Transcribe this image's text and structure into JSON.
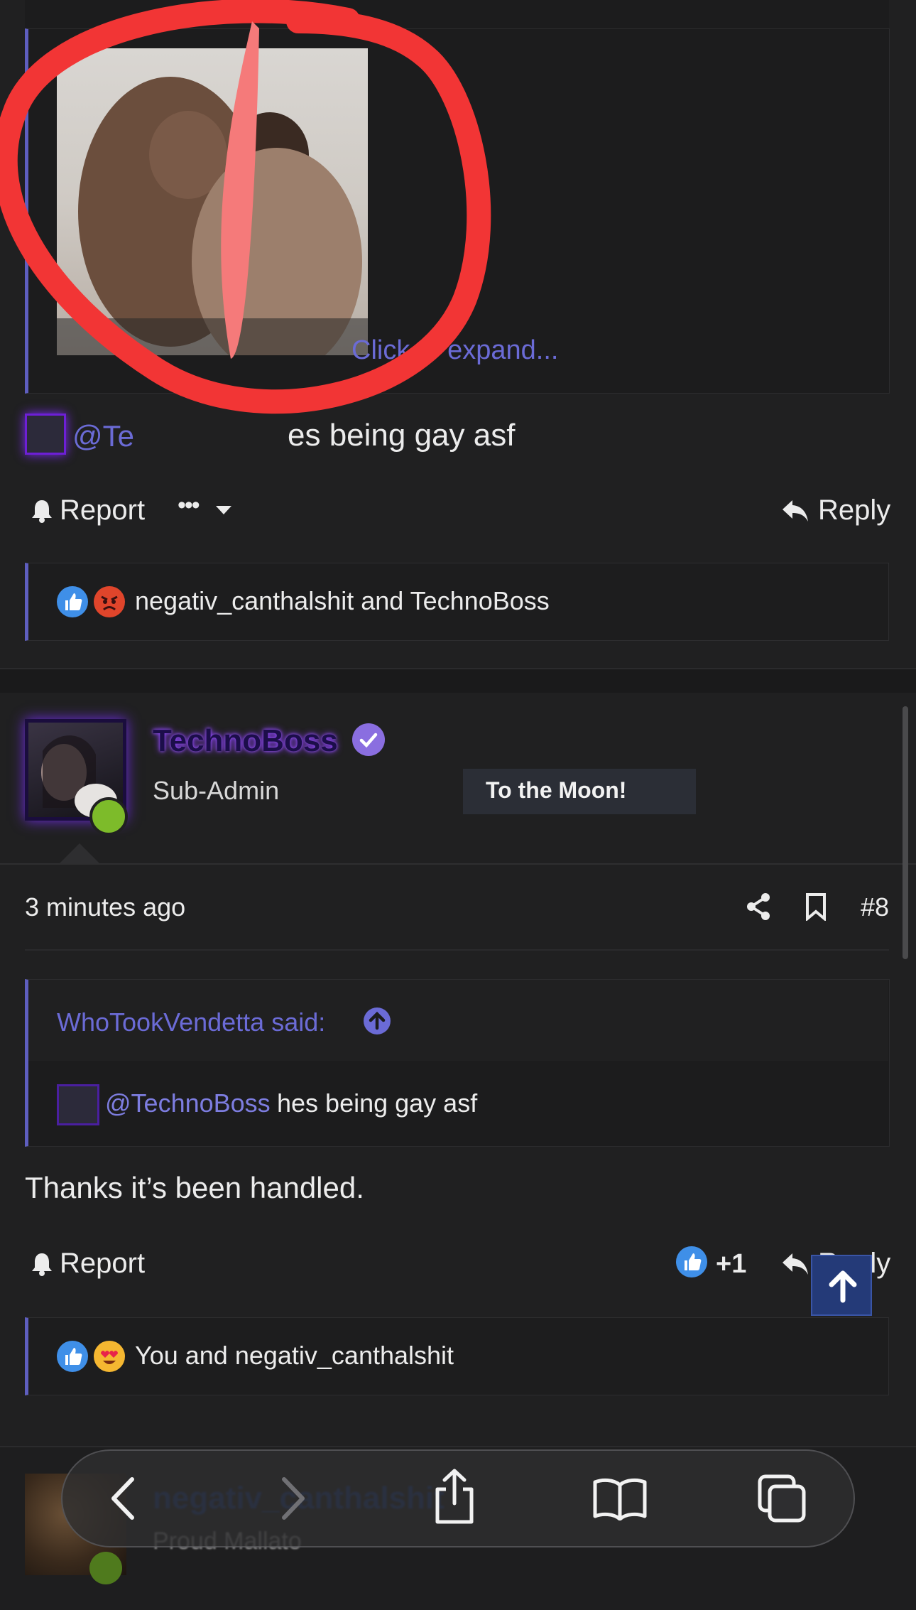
{
  "post7": {
    "quote_expand": "Click to expand...",
    "mention_text": "@TechnoBoss hes being gay asf",
    "mention_visible_left": "@Te",
    "mention_visible_right": "es being gay asf",
    "report_label": "Report",
    "more_label": "•••",
    "reply_label": "Reply",
    "reactions_text": "negativ_canthalshit and TechnoBoss"
  },
  "post8": {
    "username": "TechnoBoss",
    "role": "Sub-Admin",
    "banner": "To the Moon!",
    "time": "3 minutes ago",
    "post_number": "#8",
    "quote_author": "WhoTookVendetta said:",
    "quote_mention": "@TechnoBoss",
    "quote_text": " hes being gay asf",
    "body": "Thanks it’s been handled.",
    "report_label": "Report",
    "like_count": "+1",
    "reply_label": "Reply",
    "reactions_text": "You and negativ_canthalshit"
  },
  "post9": {
    "username_partial": "negativ_canthalshit",
    "role_partial": "Proud Mallato"
  },
  "colors": {
    "accent": "#6b6bd6",
    "mention": "#7d7de0",
    "verified": "#8a6ee0",
    "online": "#7dbb2a",
    "annotation_red": "#f23535",
    "scroll_top_button": "#243a78"
  },
  "icons": {
    "report": "bell-icon",
    "reply": "reply-arrow-icon",
    "share": "share-icon",
    "bookmark": "bookmark-icon",
    "like": "thumbs-up-icon",
    "angry": "angry-face-icon",
    "love": "heart-eyes-icon",
    "verified": "check-badge-icon",
    "quote_jump": "arrow-up-circle-icon",
    "scroll_top": "arrow-up-icon"
  }
}
